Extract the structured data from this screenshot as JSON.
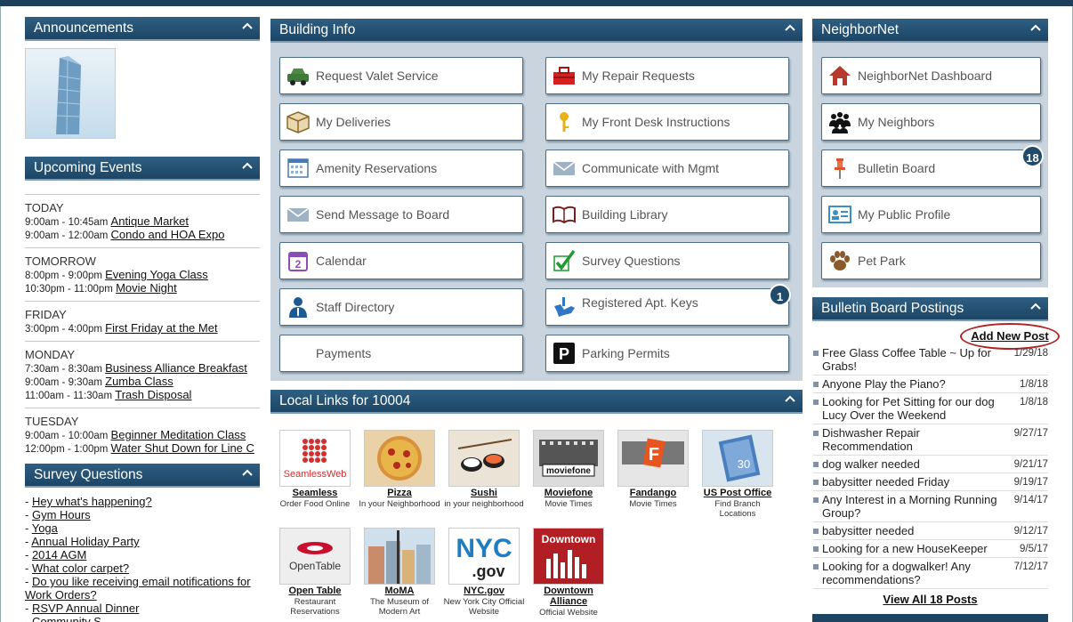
{
  "announcements": {
    "title": "Announcements"
  },
  "events": {
    "title": "Upcoming Events",
    "days": [
      {
        "day": "TODAY",
        "items": [
          {
            "time": "9:00am - 10:45am",
            "name": "Antique Market"
          },
          {
            "time": "9:00am - 12:00am",
            "name": "Condo and HOA Expo"
          }
        ]
      },
      {
        "day": "TOMORROW",
        "items": [
          {
            "time": "8:00pm - 9:00pm",
            "name": "Evening Yoga Class"
          },
          {
            "time": "10:30pm - 11:00pm",
            "name": "Movie Night"
          }
        ]
      },
      {
        "day": "FRIDAY",
        "items": [
          {
            "time": "3:00pm - 4:00pm",
            "name": "First Friday at the Met"
          }
        ]
      },
      {
        "day": "MONDAY",
        "items": [
          {
            "time": "7:30am - 8:30am",
            "name": "Business Alliance Breakfast"
          },
          {
            "time": "9:00am - 9:30am",
            "name": "Zumba Class"
          },
          {
            "time": "11:00am - 11:30am",
            "name": "Trash Disposal "
          }
        ]
      },
      {
        "day": "TUESDAY",
        "items": [
          {
            "time": "9:00am - 10:00am",
            "name": "Beginner Meditation Class"
          },
          {
            "time": "12:00pm - 1:00pm",
            "name": "Water Shut Down for Line C"
          }
        ]
      }
    ]
  },
  "survey": {
    "title": "Survey Questions",
    "items": [
      "Hey what's happening?",
      "Gym Hours",
      "Yoga",
      "Annual Holiday Party",
      "2014 AGM",
      "What color carpet?",
      "Do you like receiving email notifications for Work Orders?",
      "RSVP Annual Dinner",
      "Community S..."
    ]
  },
  "building": {
    "title": "Building Info",
    "tiles": [
      {
        "label": "Request Valet Service",
        "icon": "car-icon"
      },
      {
        "label": "My Repair Requests",
        "icon": "toolbox-icon"
      },
      {
        "label": "My Deliveries",
        "icon": "package-icon"
      },
      {
        "label": "My Front Desk Instructions",
        "icon": "key-icon"
      },
      {
        "label": "Amenity Reservations",
        "icon": "calendar-grid-icon"
      },
      {
        "label": "Communicate with Mgmt",
        "icon": "envelope-icon"
      },
      {
        "label": "Send Message to Board",
        "icon": "envelope-icon"
      },
      {
        "label": "Building Library",
        "icon": "book-icon"
      },
      {
        "label": "Calendar",
        "icon": "calendar-icon"
      },
      {
        "label": "Survey Questions",
        "icon": "checkmark-icon"
      },
      {
        "label": "Staff Directory",
        "icon": "person-icon"
      },
      {
        "label": "Registered Apt. Keys",
        "icon": "keychain-icon"
      },
      {
        "label": "Payments",
        "icon": ""
      },
      {
        "label": "Parking Permits",
        "icon": "parking-icon"
      }
    ],
    "calendar_day": "2",
    "keys_badge": "1"
  },
  "local": {
    "title": "Local Links for 10004",
    "links": [
      {
        "name": "Seamless",
        "desc": "Order Food Online",
        "img_text": "SeamlessWeb",
        "color": "#ffffff"
      },
      {
        "name": "Pizza",
        "desc": "In your Neighborhood",
        "img_text": "",
        "color": "#e9d2a8"
      },
      {
        "name": "Sushi",
        "desc": "in your neighborhood",
        "img_text": "",
        "color": "#eae3d6"
      },
      {
        "name": "Moviefone",
        "desc": "Movie Times",
        "img_text": "moviefone",
        "color": "#dcdcdc"
      },
      {
        "name": "Fandango",
        "desc": "Movie Times",
        "img_text": "F",
        "color": "#e6e6e6"
      },
      {
        "name": "US Post Office",
        "desc": "Find Branch Locations",
        "img_text": "30",
        "color": "#d8e4ee"
      },
      {
        "name": "Open Table",
        "desc": "Restaurant Reservations",
        "img_text": "OpenTable",
        "color": "#eeeeee"
      },
      {
        "name": "MoMA",
        "desc": "The Museum of Modern Art",
        "img_text": "",
        "color": "#cfe0ec"
      },
      {
        "name": "NYC.gov",
        "desc": "New York City Official Website",
        "img_text": "NYC .gov",
        "color": "#ffffff"
      },
      {
        "name": "Downtown Alliance",
        "desc": "Official Website",
        "img_text": "Downtown",
        "color": "#b11e24"
      }
    ]
  },
  "neighbor": {
    "title": "NeighborNet",
    "tiles": [
      {
        "label": "NeighborNet Dashboard",
        "icon": "house-icon"
      },
      {
        "label": "My Neighbors",
        "icon": "people-icon"
      },
      {
        "label": "Bulletin Board",
        "icon": "pushpin-icon"
      },
      {
        "label": "My Public Profile",
        "icon": "profile-card-icon"
      },
      {
        "label": "Pet Park",
        "icon": "paw-icon"
      }
    ],
    "bulletin_badge": "18"
  },
  "postings": {
    "title": "Bulletin Board Postings",
    "add": "Add New Post",
    "items": [
      {
        "t": "Free Glass Coffee Table ~ Up for Grabs!",
        "d": "1/29/18"
      },
      {
        "t": "Anyone Play the Piano?",
        "d": "1/8/18"
      },
      {
        "t": "Looking for Pet Sitting for our dog Lucy Over the Weekend",
        "d": "1/8/18"
      },
      {
        "t": "Dishwasher Repair Recommendation",
        "d": "9/27/17"
      },
      {
        "t": "dog walker needed",
        "d": "9/21/17"
      },
      {
        "t": "babysitter needed Friday",
        "d": "9/19/17"
      },
      {
        "t": "Any Interest in a Morning Running Group?",
        "d": "9/14/17"
      },
      {
        "t": "babysitter needed",
        "d": "9/12/17"
      },
      {
        "t": "Looking for a new HouseKeeper",
        "d": "9/5/17"
      },
      {
        "t": "Looking for a dogwalker! Any recommendations?",
        "d": "7/12/17"
      }
    ],
    "view_all": "View All 18 Posts"
  }
}
